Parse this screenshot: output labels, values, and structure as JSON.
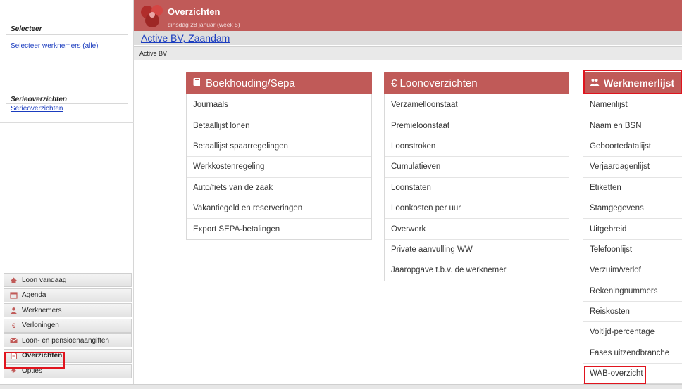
{
  "sidebar": {
    "selecteer_heading": "Selecteer",
    "selecteer_link": "Selecteer werknemers (alle)",
    "serie_heading": "Serieoverzichten",
    "serie_link": "Serieoverzichten",
    "nav": [
      {
        "label": "Loon vandaag",
        "icon": "home-icon",
        "underline": "v"
      },
      {
        "label": "Agenda",
        "icon": "calendar-icon",
        "underline": "A"
      },
      {
        "label": "Werknemers",
        "icon": "user-icon",
        "underline": "W"
      },
      {
        "label": "Verloningen",
        "icon": "euro-icon",
        "underline": ""
      },
      {
        "label": "Loon- en pensioenaangiften",
        "icon": "envelope-icon",
        "underline": ""
      },
      {
        "label": "Overzichten",
        "icon": "document-icon",
        "underline": ""
      },
      {
        "label": "Opties",
        "icon": "gear-icon",
        "underline": ""
      }
    ]
  },
  "header": {
    "title": "Overzichten",
    "date": "dinsdag 28 januari",
    "week": "(week 5)"
  },
  "company": {
    "name": "Active BV, Zaandam",
    "breadcrumb": "Active BV"
  },
  "panels": {
    "boekhouding": {
      "title": "Boekhouding/Sepa",
      "items": [
        "Journaals",
        "Betaallijst lonen",
        "Betaallijst spaarregelingen",
        "Werkkostenregeling",
        "Auto/fiets van de zaak",
        "Vakantiegeld en reserveringen",
        "Export SEPA-betalingen"
      ]
    },
    "loon": {
      "title": "€ Loonoverzichten",
      "items": [
        "Verzamelloonstaat",
        "Premieloonstaat",
        "Loonstroken",
        "Cumulatieven",
        "Loonstaten",
        "Loonkosten per uur",
        "Overwerk",
        "Private aanvulling WW",
        "Jaaropgave t.b.v. de werknemer"
      ]
    },
    "werknemer": {
      "title": "Werknemerlijst",
      "items": [
        "Namenlijst",
        "Naam en BSN",
        "Geboortedatalijst",
        "Verjaardagenlijst",
        "Etiketten",
        "Stamgegevens",
        "Uitgebreid",
        "Telefoonlijst",
        "Verzuim/verlof",
        "Rekeningnummers",
        "Reiskosten",
        "Voltijd-percentage",
        "Fases uitzendbranche",
        "WAB-overzicht"
      ]
    }
  },
  "colors": {
    "accent": "#c05a58",
    "link": "#1a3cbf",
    "highlight": "#e0141e"
  }
}
